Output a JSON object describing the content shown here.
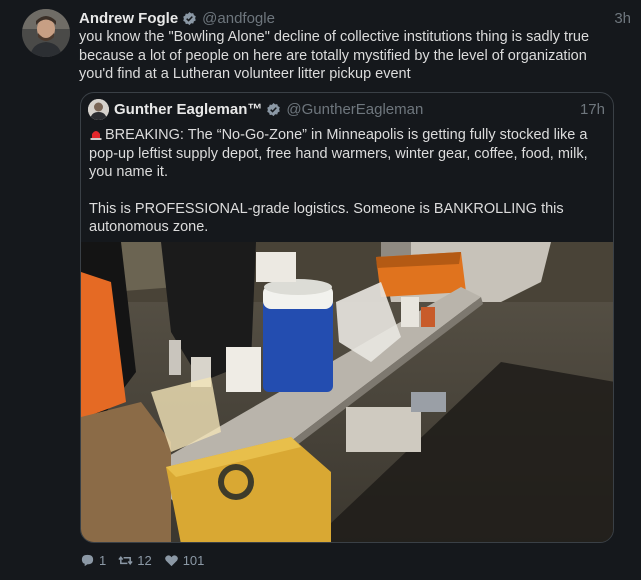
{
  "tweet": {
    "name": "Andrew Fogle",
    "handle": "@andfogle",
    "time": "3h",
    "text": "you know the \"Bowling Alone\" decline of collective institutions thing is sadly true because a lot of people on here are totally mystified by the level of organization you'd find at a Lutheran volunteer litter pickup event",
    "avatar_icon": "user-avatar"
  },
  "quoted": {
    "name": "Gunther Eagleman™",
    "handle": "@GuntherEagleman",
    "time": "17h",
    "line1": "BREAKING: The “No-Go-Zone” in Minneapolis is getting fully stocked like a pop-up leftist supply depot, free hand warmers, winter gear, coffee, food, milk, you name it.",
    "line2": "This is PROFESSIONAL-grade logistics. Someone is BANKROLLING this autonomous zone.",
    "siren_icon": "siren-emoji",
    "photo_desc_icon": "supply-table-photo"
  },
  "actions": {
    "replies": "1",
    "retweets": "12",
    "likes": "101"
  },
  "colors": {
    "background": "#15181c",
    "verified": "#8b98a5",
    "text": "#dcdcdc",
    "muted": "#6e767d"
  }
}
